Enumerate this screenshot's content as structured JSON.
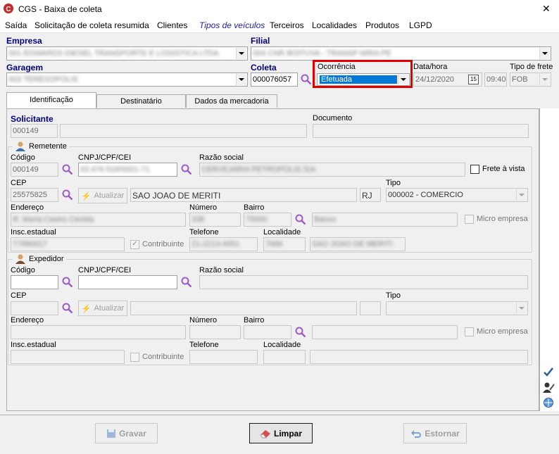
{
  "window": {
    "title": "CGS - Baixa de coleta",
    "close": "✕"
  },
  "menu": [
    "Saída",
    "Solicitação de coleta resumida",
    "Clientes",
    "Tipos de veículos",
    "Terceiros",
    "Localidades",
    "Produtos",
    "LGPD"
  ],
  "header": {
    "empresa_label": "Empresa",
    "empresa_value": "001 EDWARDS DIESEL TRANSPORTE E LOGISTICA LTDA",
    "filial_label": "Filial",
    "filial_value": "004 CNR BOITUVA - TRANSP MIRA PE",
    "garagem_label": "Garagem",
    "garagem_value": "003 TERESOPOLIS",
    "coleta_label": "Coleta",
    "coleta_value": "000076057",
    "ocorrencia_label": "Ocorrência",
    "ocorrencia_value": "Efetuada",
    "datahora_label": "Data/hora",
    "date_value": "24/12/2020",
    "time_value": "09:40",
    "calendar_icon": "15",
    "tipo_frete_label": "Tipo de frete",
    "tipo_frete_value": "FOB"
  },
  "tabs": [
    "Identificação",
    "Destinatário",
    "Dados da mercadoria"
  ],
  "solicitante": {
    "label": "Solicitante",
    "value": "000149",
    "documento_label": "Documento"
  },
  "remetente": {
    "title": "Remetente",
    "codigo_label": "Código",
    "codigo_value": "000149",
    "cnpj_label": "CNPJ/CPF/CEI",
    "cnpj_value": "03.476.516/0001-71",
    "razao_label": "Razão social",
    "razao_value": "CERVEJARIA PETROPOLIS S/A",
    "frete_vista_label": "Frete à vista",
    "cep_label": "CEP",
    "cep_value": "25575825",
    "atualizar_label": "Atualizar",
    "cidade_value": "SAO JOAO DE MERITI",
    "uf_value": "RJ",
    "tipo_label": "Tipo",
    "tipo_value": "000002 - COMERCIO",
    "endereco_label": "Endereço",
    "endereco_value": "R. Maria Castro Cenida",
    "numero_label": "Número",
    "numero_value": "338",
    "bairro_label": "Bairro",
    "bairro_value": "75000",
    "bairro_name": "Banco",
    "micro_label": "Micro empresa",
    "insc_label": "Insc.estadual",
    "insc_value": "77990017",
    "contribuinte_label": "Contribuinte",
    "telefone_label": "Telefone",
    "telefone_value": "21-2213-4451",
    "localidade_label": "Localidade",
    "localidade_code": "7686",
    "localidade_value": "SAO JOAO DE MERITI"
  },
  "expedidor": {
    "title": "Expedidor",
    "codigo_label": "Código",
    "cnpj_label": "CNPJ/CPF/CEI",
    "razao_label": "Razão social",
    "cep_label": "CEP",
    "atualizar_label": "Atualizar",
    "tipo_label": "Tipo",
    "endereco_label": "Endereço",
    "numero_label": "Número",
    "bairro_label": "Bairro",
    "micro_label": "Micro empresa",
    "insc_label": "Insc.estadual",
    "contribuinte_label": "Contribuinte",
    "telefone_label": "Telefone",
    "localidade_label": "Localidade"
  },
  "footer": {
    "gravar": "Gravar",
    "limpar": "Limpar",
    "estornar": "Estornar"
  },
  "colors": {
    "accent": "#00007f",
    "highlight": "#e00000",
    "selection": "#0078d7"
  }
}
